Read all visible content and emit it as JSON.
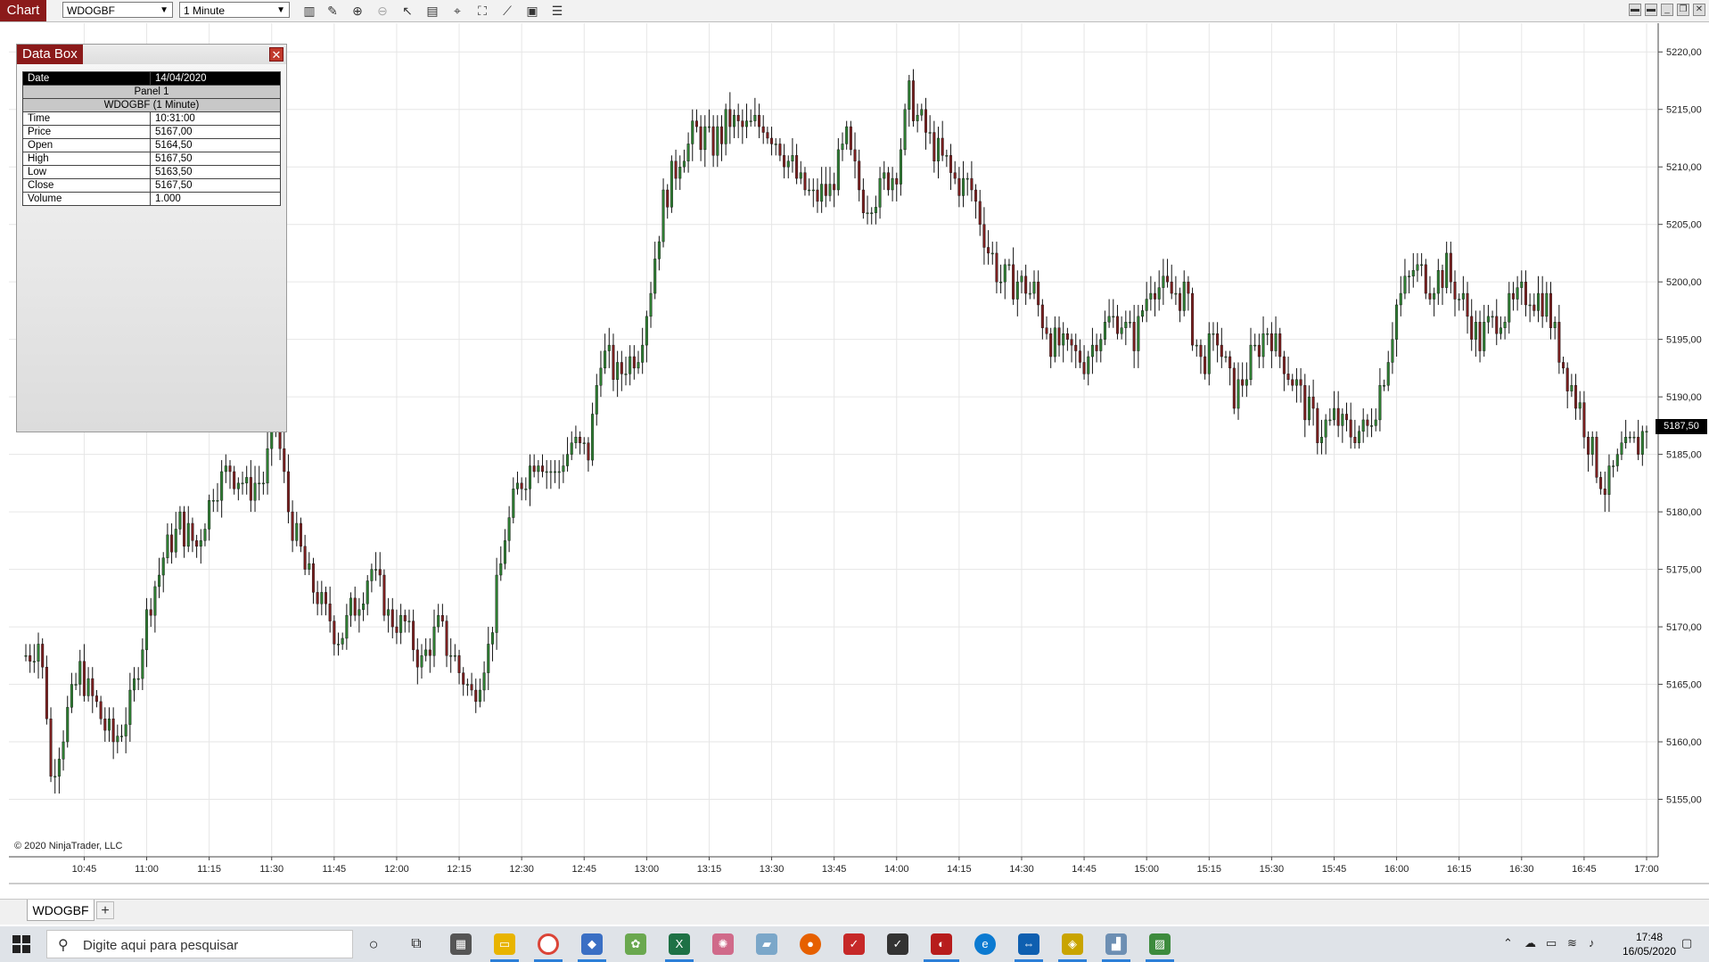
{
  "toolbar": {
    "chart_label": "Chart",
    "instrument": "WDOGBF",
    "interval": "1 Minute"
  },
  "databox": {
    "title": "Data Box",
    "date_label": "Date",
    "date_value": "14/04/2020",
    "panel": "Panel 1",
    "series": "WDOGBF (1 Minute)",
    "rows": [
      {
        "label": "Time",
        "value": "10:31:00"
      },
      {
        "label": "Price",
        "value": "5167,00"
      },
      {
        "label": "Open",
        "value": "5164,50"
      },
      {
        "label": "High",
        "value": "5167,50"
      },
      {
        "label": "Low",
        "value": "5163,50"
      },
      {
        "label": "Close",
        "value": "5167,50"
      },
      {
        "label": "Volume",
        "value": "1.000"
      }
    ]
  },
  "copyright": "© 2020 NinjaTrader, LLC",
  "last_price": "5187,50",
  "bottom_tab": "WDOGBF",
  "add_tab": "+",
  "taskbar": {
    "search_placeholder": "Digite aqui para pesquisar",
    "time": "17:48",
    "date": "16/05/2020"
  },
  "colors": {
    "up": "#2e7d32",
    "down": "#7a1f1f",
    "accent": "#8b1a1a",
    "grid": "#e6e6e6"
  },
  "chart_data": {
    "type": "candlestick",
    "instrument": "WDOGBF",
    "interval": "1 Minute",
    "ylim": [
      5150,
      5222.5
    ],
    "y_ticks": [
      "5155,00",
      "5160,00",
      "5165,00",
      "5170,00",
      "5175,00",
      "5180,00",
      "5185,00",
      "5190,00",
      "5195,00",
      "5200,00",
      "5205,00",
      "5210,00",
      "5215,00",
      "5220,00"
    ],
    "x_ticks": [
      "10:45",
      "11:00",
      "11:15",
      "11:30",
      "11:45",
      "12:00",
      "12:15",
      "12:30",
      "12:45",
      "13:00",
      "13:15",
      "13:30",
      "13:45",
      "14:00",
      "14:15",
      "14:30",
      "14:45",
      "15:00",
      "15:15",
      "15:30",
      "15:45",
      "16:00",
      "16:15",
      "16:30",
      "16:45",
      "17:00"
    ],
    "x_start": "10:31",
    "x_end": "17:00",
    "close_path": [
      [
        "10:31",
        5167.5
      ],
      [
        "10:34",
        5169
      ],
      [
        "10:36",
        5163
      ],
      [
        "10:37",
        5157
      ],
      [
        "10:40",
        5161
      ],
      [
        "10:44",
        5166
      ],
      [
        "10:48",
        5163
      ],
      [
        "10:52",
        5160
      ],
      [
        "10:56",
        5163
      ],
      [
        "11:00",
        5171
      ],
      [
        "11:04",
        5176
      ],
      [
        "11:08",
        5179
      ],
      [
        "11:12",
        5177
      ],
      [
        "11:16",
        5182
      ],
      [
        "11:20",
        5184
      ],
      [
        "11:24",
        5182
      ],
      [
        "11:28",
        5183
      ],
      [
        "11:31",
        5188
      ],
      [
        "11:34",
        5180
      ],
      [
        "11:38",
        5175
      ],
      [
        "11:42",
        5172
      ],
      [
        "11:46",
        5169
      ],
      [
        "11:50",
        5172
      ],
      [
        "11:54",
        5175
      ],
      [
        "11:58",
        5171
      ],
      [
        "12:02",
        5170
      ],
      [
        "12:06",
        5167
      ],
      [
        "12:10",
        5170
      ],
      [
        "12:14",
        5167
      ],
      [
        "12:18",
        5164
      ],
      [
        "12:22",
        5168
      ],
      [
        "12:26",
        5178
      ],
      [
        "12:30",
        5183
      ],
      [
        "12:34",
        5185
      ],
      [
        "12:38",
        5183
      ],
      [
        "12:42",
        5186
      ],
      [
        "12:46",
        5185
      ],
      [
        "12:49",
        5194
      ],
      [
        "12:53",
        5192
      ],
      [
        "12:58",
        5194
      ],
      [
        "13:01",
        5200
      ],
      [
        "13:04",
        5207
      ],
      [
        "13:08",
        5211
      ],
      [
        "13:12",
        5213
      ],
      [
        "13:16",
        5212
      ],
      [
        "13:20",
        5214
      ],
      [
        "13:24",
        5213
      ],
      [
        "13:28",
        5214
      ],
      [
        "13:32",
        5212
      ],
      [
        "13:36",
        5209
      ],
      [
        "13:40",
        5207
      ],
      [
        "13:44",
        5208
      ],
      [
        "13:48",
        5212
      ],
      [
        "13:52",
        5207
      ],
      [
        "13:56",
        5208
      ],
      [
        "14:00",
        5210
      ],
      [
        "14:03",
        5216
      ],
      [
        "14:07",
        5213
      ],
      [
        "14:10",
        5211
      ],
      [
        "14:14",
        5209
      ],
      [
        "14:18",
        5208
      ],
      [
        "14:22",
        5203
      ],
      [
        "14:25",
        5200
      ],
      [
        "14:29",
        5200
      ],
      [
        "14:33",
        5199
      ],
      [
        "14:37",
        5195
      ],
      [
        "14:41",
        5194
      ],
      [
        "14:45",
        5193
      ],
      [
        "14:49",
        5196
      ],
      [
        "14:53",
        5197
      ],
      [
        "14:57",
        5195
      ],
      [
        "15:01",
        5200
      ],
      [
        "15:05",
        5199
      ],
      [
        "15:09",
        5199
      ],
      [
        "15:13",
        5193
      ],
      [
        "15:17",
        5195
      ],
      [
        "15:21",
        5190
      ],
      [
        "15:25",
        5193
      ],
      [
        "15:29",
        5196
      ],
      [
        "15:33",
        5193
      ],
      [
        "15:37",
        5190
      ],
      [
        "15:41",
        5187
      ],
      [
        "15:45",
        5188
      ],
      [
        "15:49",
        5187
      ],
      [
        "15:53",
        5187
      ],
      [
        "15:57",
        5192
      ],
      [
        "16:00",
        5198
      ],
      [
        "16:04",
        5201
      ],
      [
        "16:08",
        5200
      ],
      [
        "16:12",
        5201
      ],
      [
        "16:16",
        5198
      ],
      [
        "16:20",
        5195
      ],
      [
        "16:24",
        5197
      ],
      [
        "16:28",
        5198
      ],
      [
        "16:32",
        5199
      ],
      [
        "16:36",
        5198
      ],
      [
        "16:40",
        5193
      ],
      [
        "16:44",
        5189
      ],
      [
        "16:48",
        5184
      ],
      [
        "16:50",
        5182
      ],
      [
        "16:54",
        5185
      ],
      [
        "16:58",
        5186
      ],
      [
        "17:00",
        5187.5
      ]
    ]
  }
}
